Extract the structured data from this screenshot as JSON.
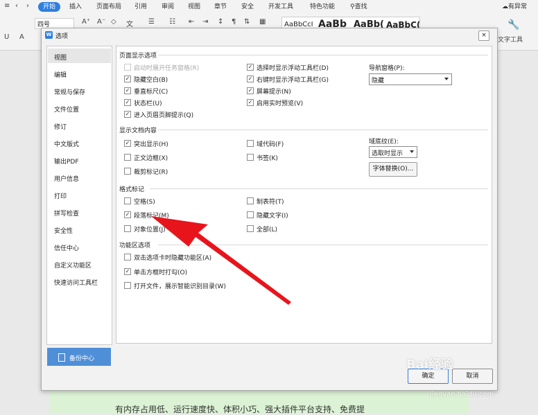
{
  "ribbon": {
    "tabs": [
      {
        "label": "开始"
      },
      {
        "label": "插入"
      },
      {
        "label": "页面布局"
      },
      {
        "label": "引用"
      },
      {
        "label": "审阅"
      },
      {
        "label": "视图"
      },
      {
        "label": "章节"
      },
      {
        "label": "安全"
      },
      {
        "label": "开发工具"
      },
      {
        "label": "特色功能"
      }
    ],
    "search_label": "查找",
    "cloud_label": "有异常",
    "font_size": "四号",
    "styles": [
      "AaBbCcI",
      "AaBb",
      "AaBb(",
      "AaBbC("
    ],
    "text_tool_label": "文字工具"
  },
  "background_text": "有内存占用低、运行速度快、体积小巧、强大插件平台支持、免费提",
  "dialog": {
    "title": "选项",
    "close_glyph": "×",
    "nav": [
      {
        "label": "视图"
      },
      {
        "label": "编辑"
      },
      {
        "label": "常规与保存"
      },
      {
        "label": "文件位置"
      },
      {
        "label": "修订"
      },
      {
        "label": "中文版式"
      },
      {
        "label": "输出PDF"
      },
      {
        "label": "用户信息"
      },
      {
        "label": "打印"
      },
      {
        "label": "拼写检查"
      },
      {
        "label": "安全性"
      },
      {
        "label": "信任中心"
      },
      {
        "label": "自定义功能区"
      },
      {
        "label": "快速访问工具栏"
      }
    ],
    "backup_label": "备份中心",
    "sections": {
      "page_display": "页面显示选项",
      "doc_content": "显示文档内容",
      "format_marks": "格式标记",
      "ribbon_options": "功能区选项"
    },
    "page_display_options": [
      {
        "label": "启动时展开任务窗格(R)",
        "checked": false,
        "disabled": true
      },
      {
        "label": "隐藏空白(B)",
        "checked": true
      },
      {
        "label": "垂直标尺(C)",
        "checked": true
      },
      {
        "label": "状态栏(U)",
        "checked": true
      },
      {
        "label": "进入页眉页脚提示(Q)",
        "checked": true
      },
      {
        "label": "选择时显示浮动工具栏(D)",
        "checked": true
      },
      {
        "label": "右键时显示浮动工具栏(G)",
        "checked": true
      },
      {
        "label": "屏幕提示(N)",
        "checked": true
      },
      {
        "label": "启用实时预览(V)",
        "checked": true
      }
    ],
    "nav_pane_label": "导航窗格(P):",
    "nav_pane_value": "隐藏",
    "doc_content_options": [
      {
        "label": "突出显示(H)",
        "checked": true
      },
      {
        "label": "正文边框(X)",
        "checked": false
      },
      {
        "label": "裁剪标记(R)",
        "checked": false
      },
      {
        "label": "域代码(F)",
        "checked": false
      },
      {
        "label": "书签(K)",
        "checked": false
      }
    ],
    "field_shading_label": "域底纹(E):",
    "field_shading_value": "选取时显示",
    "font_substitution_button": "字体替换(O)...",
    "format_mark_options": [
      {
        "label": "空格(S)",
        "checked": false
      },
      {
        "label": "段落标记(M)",
        "checked": true
      },
      {
        "label": "对象位置(J)",
        "checked": false
      },
      {
        "label": "制表符(T)",
        "checked": false
      },
      {
        "label": "隐藏文字(I)",
        "checked": false
      },
      {
        "label": "全部(L)",
        "checked": false
      }
    ],
    "ribbon_option_items": [
      {
        "label": "双击选项卡时隐藏功能区(A)",
        "checked": false
      },
      {
        "label": "单击方框时打勾(O)",
        "checked": true
      },
      {
        "label": "打开文件，展示智能识别目录(W)",
        "checked": false
      }
    ],
    "ok_label": "确定",
    "cancel_label": "取消"
  },
  "watermark": {
    "main": "Bai经验",
    "sub": "jingyan.baidu.com"
  },
  "colors": {
    "accent": "#2f7fe0",
    "arrow": "#e8141c",
    "backup": "#4f8fd8",
    "doc_bg": "#dbf3d4"
  }
}
